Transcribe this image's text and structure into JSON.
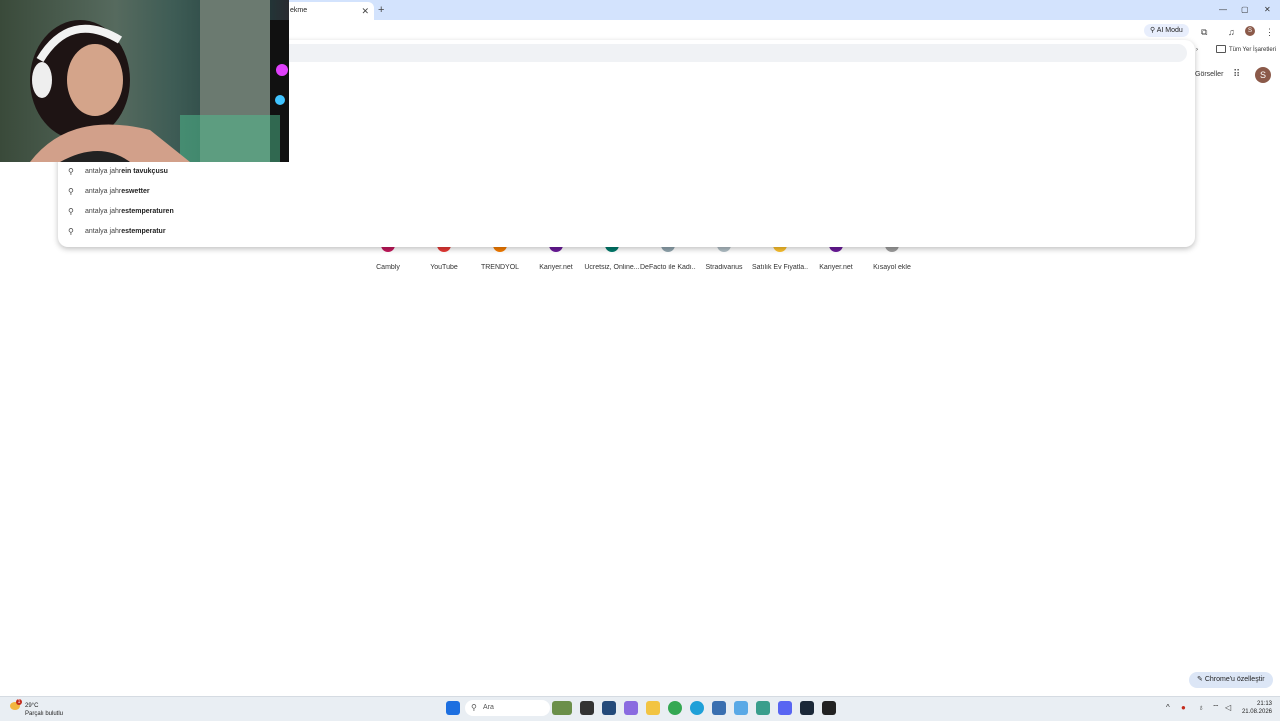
{
  "browser": {
    "tab_title": "ekme",
    "tab_close": "✕",
    "new_tab": "+",
    "ai_mode": "AI Modu",
    "bookmarks_label": "Tüm Yer İşaretleri",
    "profile_initial": "S",
    "window_controls": [
      "—",
      "▢",
      "✕"
    ]
  },
  "header": {
    "images_link": "Görseller",
    "profile_initial": "S"
  },
  "omnibox": {
    "input_value": "",
    "suggestions": [
      {
        "prefix": "antalya jahr",
        "completion": "ein tavukçusu"
      },
      {
        "prefix": "antalya jahr",
        "completion": "eswetter"
      },
      {
        "prefix": "antalya jahr",
        "completion": "estemperaturen"
      },
      {
        "prefix": "antalya jahr",
        "completion": "estemperatur"
      }
    ]
  },
  "shortcuts": [
    {
      "label": "Cambly",
      "color": "#c2185b"
    },
    {
      "label": "YouTube",
      "color": "#e53935"
    },
    {
      "label": "TRENDYOL",
      "color": "#f57c00"
    },
    {
      "label": "Kariyer.net",
      "color": "#6a1b9a"
    },
    {
      "label": "Ücretsiz, Online...",
      "color": "#00796b"
    },
    {
      "label": "DeFacto ile Kadı...",
      "color": "#90a4ae"
    },
    {
      "label": "Stradivarius",
      "color": "#b0bec5"
    },
    {
      "label": "Satılık Ev Fiyatla...",
      "color": "#fbc02d"
    },
    {
      "label": "Kariyer.net",
      "color": "#6a1b9a"
    },
    {
      "label": "Kısayol ekle",
      "color": "#9e9e9e"
    }
  ],
  "customize_button": "Chrome'u özelleştir",
  "taskbar": {
    "weather_temp": "29°C",
    "weather_desc": "Parçalı bulutlu",
    "weather_badge": "1",
    "search_placeholder": "Ara",
    "time": "21:13",
    "date": "21.08.2026"
  }
}
